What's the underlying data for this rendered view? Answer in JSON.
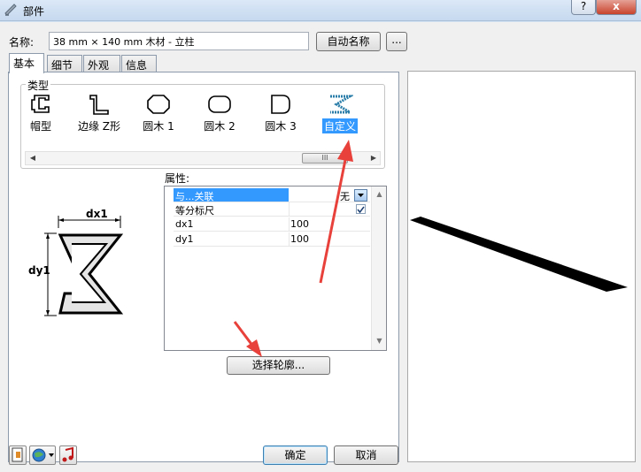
{
  "window": {
    "title": "部件",
    "help_label": "?",
    "close_label": "x"
  },
  "name_row": {
    "label": "名称:",
    "value": "38 mm × 140 mm 木材 - 立柱",
    "auto_name_button": "自动名称",
    "browse_button": "..."
  },
  "tabs": [
    {
      "label": "基本",
      "active": true
    },
    {
      "label": "细节",
      "active": false
    },
    {
      "label": "外观",
      "active": false
    },
    {
      "label": "信息",
      "active": false
    }
  ],
  "type_group": {
    "label": "类型",
    "items": [
      {
        "label": "帽型",
        "icon": "hat-profile-icon"
      },
      {
        "label": "边缘 Z形",
        "icon": "z-edge-profile-icon"
      },
      {
        "label": "圆木 1",
        "icon": "octagon-profile-icon"
      },
      {
        "label": "圆木 2",
        "icon": "rounded-rect-profile-icon"
      },
      {
        "label": "圆木 3",
        "icon": "d-shape-profile-icon"
      },
      {
        "label": "自定义",
        "icon": "custom-profile-icon",
        "selected": true
      }
    ],
    "scroll_grip": "III",
    "scroll_left": "◀",
    "scroll_right": "▶"
  },
  "diagram": {
    "dx_label": "dx1",
    "dy_label": "dy1"
  },
  "properties": {
    "label": "属性:",
    "rows": [
      {
        "name": "与...关联",
        "value": "无",
        "type": "dropdown",
        "selected": true
      },
      {
        "name": "等分标尺",
        "value": "",
        "type": "checkbox",
        "checked": true
      },
      {
        "name": "dx1",
        "value": "100"
      },
      {
        "name": "dy1",
        "value": "100"
      }
    ],
    "scroll_up": "▲",
    "scroll_down": "▼"
  },
  "select_profile_button": "选择轮廓...",
  "footer": {
    "ok": "确定",
    "cancel": "取消"
  },
  "colors": {
    "selection": "#3399ff",
    "annotation_arrow": "#e8403a",
    "preview_beam": "#000000"
  }
}
